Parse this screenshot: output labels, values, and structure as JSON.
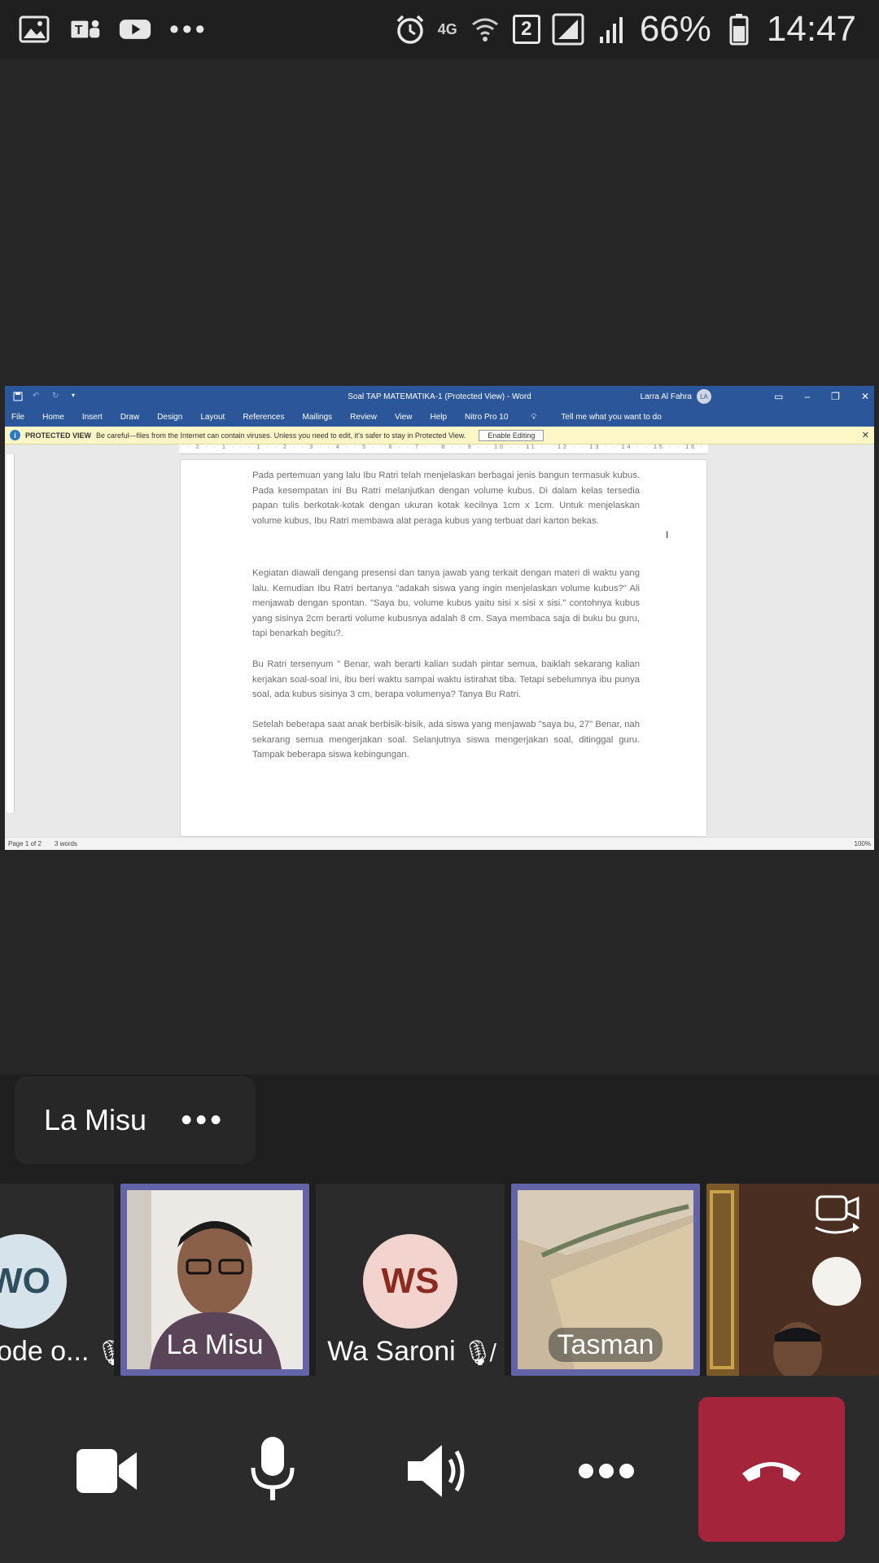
{
  "status_bar": {
    "network": "4G",
    "sim_badge": "2",
    "battery": "66%",
    "time": "14:47"
  },
  "word": {
    "title": "Soal TAP MATEMATIKA-1 (Protected View) - Word",
    "user_name": "Larra Al Fahra",
    "user_initials": "LA",
    "menu": [
      "File",
      "Home",
      "Insert",
      "Draw",
      "Design",
      "Layout",
      "References",
      "Mailings",
      "Review",
      "View",
      "Help",
      "Nitro Pro 10"
    ],
    "tell_me": "Tell me what you want to do",
    "protected_label": "PROTECTED VIEW",
    "protected_msg": "Be careful—files from the Internet can contain viruses. Unless you need to edit, it's safer to stay in Protected View.",
    "enable_editing": "Enable Editing",
    "paragraphs": [
      "Pada pertemuan yang lalu Ibu Ratri telah menjelaskan berbagai jenis bangun termasuk kubus. Pada kesempatan ini Bu Ratri melanjutkan dengan volume kubus. Di dalam kelas tersedia papan tulis berkotak-kotak dengan ukuran kotak kecilnya 1cm x 1cm. Untuk menjelaskan volume kubus, Ibu Ratri membawa alat peraga kubus yang terbuat dari karton bekas.",
      "Kegiatan diawali dengang presensi dan tanya jawab yang terkait dengan materi di waktu yang lalu. Kemudian Ibu Ratri bertanya \"adakah siswa yang ingin menjelaskan volume kubus?\" Ali menjawab dengan spontan. \"Saya bu, volume kubus yaitu sisi x sisi x sisi.\" contohnya kubus yang sisinya 2cm berarti volume kubusnya adalah 8 cm. Saya membaca saja di buku bu guru, tapi benarkah begitu?.",
      "Bu Ratri tersenyum \" Benar, wah berarti kalian sudah pintar semua, baiklah sekarang kalian kerjakan soal-soal ini, ibu beri waktu sampai waktu istirahat tiba. Tetapi sebelumnya ibu punya soal, ada kubus sisinya 3 cm, berapa volumenya? Tanya Bu Ratri.",
      "Setelah beberapa saat anak berbisik-bisik, ada siswa yang menjawab \"saya bu, 27\" Benar, nah sekarang semua mengerjakan soal. Selanjutnya siswa mengerjakan soal, ditinggal guru. Tampak beberapa siswa kebingungan."
    ],
    "page_info": "Page 1 of 2",
    "word_count": "3 words",
    "zoom": "100%"
  },
  "speaker": {
    "name": "La Misu",
    "more": "•••"
  },
  "participants": [
    {
      "initials": "WO",
      "name": "ode o...",
      "muted": true,
      "avatar_color": "#d7e3ea",
      "initials_color": "#2f4f5f"
    },
    {
      "name": "La Misu",
      "muted": false,
      "video": true
    },
    {
      "initials": "WS",
      "name": "Wa Saroni",
      "muted": true,
      "avatar_color": "#f2d3cd",
      "initials_color": "#8b2a1e"
    },
    {
      "name": "Tasman",
      "muted": false,
      "video": true
    },
    {
      "name": "",
      "muted": false,
      "video": true
    }
  ],
  "colors": {
    "accent": "#6264a7",
    "hangup": "#a4243b",
    "word_blue": "#2b579a"
  }
}
